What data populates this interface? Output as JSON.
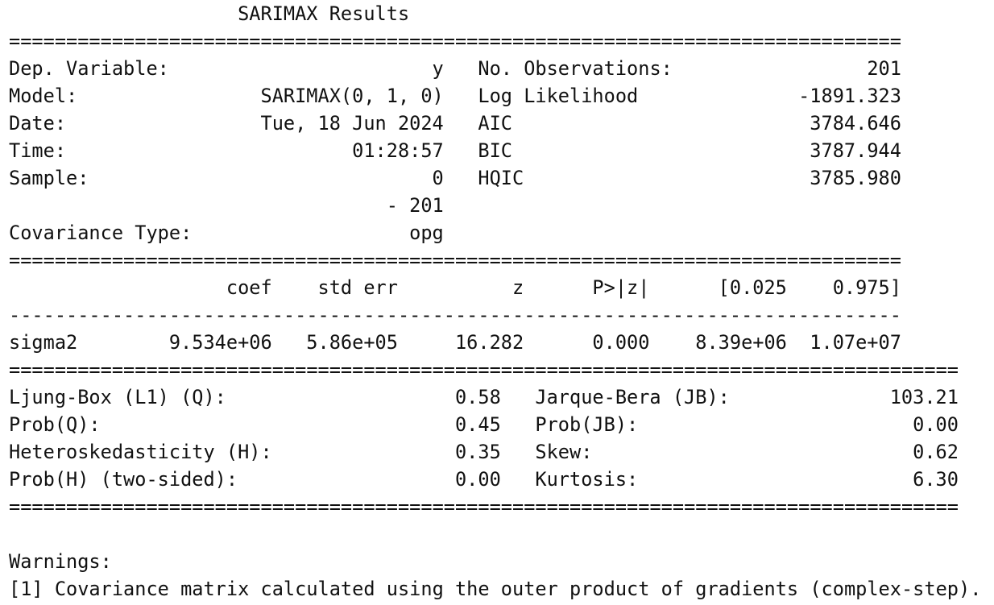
{
  "title": "SARIMAX Results",
  "rules": {
    "double_78": "==============================================================================",
    "double_83": "===================================================================================",
    "single_78": "------------------------------------------------------------------------------"
  },
  "model_info": {
    "left": [
      {
        "label": "Dep. Variable:",
        "value": "y"
      },
      {
        "label": "Model:",
        "value": "SARIMAX(0, 1, 0)"
      },
      {
        "label": "Date:",
        "value": "Tue, 18 Jun 2024"
      },
      {
        "label": "Time:",
        "value": "01:28:57"
      },
      {
        "label": "Sample:",
        "value": "0"
      },
      {
        "label": "",
        "value": "- 201"
      },
      {
        "label": "Covariance Type:",
        "value": "opg"
      }
    ],
    "right": [
      {
        "label": "No. Observations:",
        "value": "201"
      },
      {
        "label": "Log Likelihood",
        "value": "-1891.323"
      },
      {
        "label": "AIC",
        "value": "3784.646"
      },
      {
        "label": "BIC",
        "value": "3787.944"
      },
      {
        "label": "HQIC",
        "value": "3785.980"
      }
    ]
  },
  "coef_table": {
    "headers": [
      "coef",
      "std err",
      "z",
      "P>|z|",
      "[0.025",
      "0.975]"
    ],
    "rows": [
      {
        "name": "sigma2",
        "values": [
          "9.534e+06",
          "5.86e+05",
          "16.282",
          "0.000",
          "8.39e+06",
          "1.07e+07"
        ]
      }
    ]
  },
  "diagnostics": {
    "left": [
      {
        "label": "Ljung-Box (L1) (Q):",
        "value": "0.58"
      },
      {
        "label": "Prob(Q):",
        "value": "0.45"
      },
      {
        "label": "Heteroskedasticity (H):",
        "value": "0.35"
      },
      {
        "label": "Prob(H) (two-sided):",
        "value": "0.00"
      }
    ],
    "right": [
      {
        "label": "Jarque-Bera (JB):",
        "value": "103.21"
      },
      {
        "label": "Prob(JB):",
        "value": "0.00"
      },
      {
        "label": "Skew:",
        "value": "0.62"
      },
      {
        "label": "Kurtosis:",
        "value": "6.30"
      }
    ]
  },
  "warnings": {
    "heading": "Warnings:",
    "items": [
      "[1] Covariance matrix calculated using the outer product of gradients (complex-step)."
    ]
  }
}
